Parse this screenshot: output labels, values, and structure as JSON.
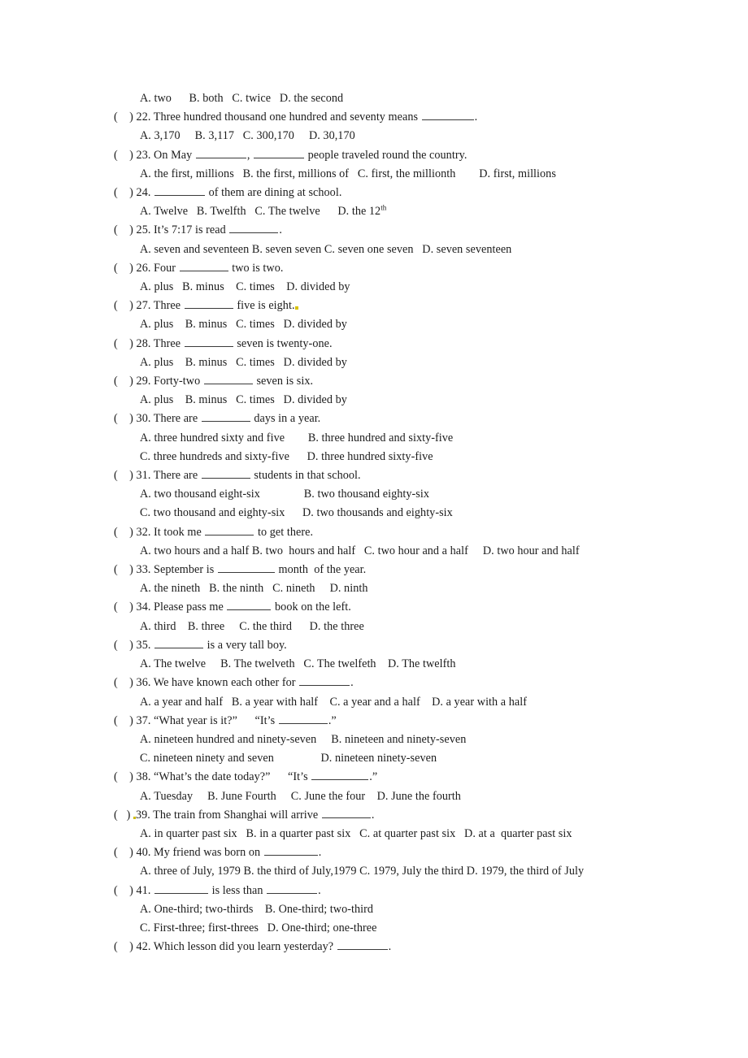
{
  "document": {
    "type": "worksheet",
    "subject": "English grammar multiple-choice exercise",
    "topic": "numbers, ordinals, fractions and dates",
    "page_background": "#ffffff",
    "text_color": "#1c1c1c",
    "artifact_color": "#d8c200"
  },
  "orphan_options": {
    "label": "A. two      B. both   C. twice   D. the second"
  },
  "questions": [
    {
      "id": "q22",
      "box": "(    ) ",
      "number": "22.",
      "stem": " Three hundred thousand one hundred and seventy means ",
      "stem_tail": ".",
      "options": [
        {
          "lines": [
            "A. 3,170     B. 3,117   C. 300,170     D. 30,170"
          ]
        }
      ]
    },
    {
      "id": "q23",
      "box": "(    ) ",
      "number": "23.",
      "stem": " On May ",
      "stem_mid": ", ",
      "stem_tail": " people traveled round the country.",
      "options": [
        {
          "lines": [
            "A. the first, millions   B. the first, millions of   C. first, the millionth        D. first, millions"
          ]
        }
      ]
    },
    {
      "id": "q24",
      "box": "(    ) ",
      "number": "24.",
      "stem": " ",
      "stem_tail": " of them are dining at school.",
      "options": [
        {
          "lines": [
            "A. Twelve   B. Twelfth   C. The twelve      D. the 12"
          ],
          "superscript": "th"
        }
      ]
    },
    {
      "id": "q25",
      "box": "(    ) ",
      "number": "25.",
      "stem": " It’s 7:17 is read ",
      "stem_tail": ".",
      "options": [
        {
          "lines": [
            "A. seven and seventeen B. seven seven C. seven one seven   D. seven seventeen"
          ]
        }
      ]
    },
    {
      "id": "q26",
      "box": "(    ) ",
      "number": "26.",
      "stem": " Four ",
      "stem_tail": " two is two.",
      "options": [
        {
          "lines": [
            "A. plus   B. minus    C. times    D. divided by"
          ]
        }
      ]
    },
    {
      "id": "q27",
      "box": "(    ) ",
      "number": "27.",
      "stem": " Three ",
      "stem_tail": " five is eight.",
      "options": [
        {
          "lines": [
            "A. plus    B. minus   C. times   D. divided by"
          ]
        }
      ]
    },
    {
      "id": "q28",
      "box": "(    ) ",
      "number": "28.",
      "stem": " Three ",
      "stem_tail": " seven is twenty-one.",
      "options": [
        {
          "lines": [
            "A. plus    B. minus   C. times   D. divided by"
          ]
        }
      ]
    },
    {
      "id": "q29",
      "box": "(    ) ",
      "number": "29.",
      "stem": " Forty-two ",
      "stem_tail": " seven is six.",
      "options": [
        {
          "lines": [
            "A. plus    B. minus   C. times   D. divided by"
          ]
        }
      ]
    },
    {
      "id": "q30",
      "box": "(    ) ",
      "number": "30.",
      "stem": " There are ",
      "stem_tail": " days in a year.",
      "options": [
        {
          "lines": [
            "A. three hundred sixty and five        B. three hundred and sixty-five"
          ]
        },
        {
          "lines": [
            "C. three hundreds and sixty-five      D. three hundred sixty-five"
          ]
        }
      ]
    },
    {
      "id": "q31",
      "box": "(    ) ",
      "number": "31.",
      "stem": " There are ",
      "stem_tail": " students in that school.",
      "options": [
        {
          "lines": [
            "A. two thousand eight-six               B. two thousand eighty-six"
          ]
        },
        {
          "lines": [
            "C. two thousand and eighty-six      D. two thousands and eighty-six"
          ]
        }
      ]
    },
    {
      "id": "q32",
      "box": "(    ) ",
      "number": "32.",
      "stem": " It took me ",
      "stem_tail": " to get there.",
      "options": [
        {
          "lines": [
            "A. two hours and a half B. two  hours and half   C. two hour and a half     D. two hour and half"
          ]
        }
      ]
    },
    {
      "id": "q33",
      "box": "(    ) ",
      "number": "33.",
      "stem": " September is ",
      "stem_tail": " month  of the year.",
      "options": [
        {
          "lines": [
            "A. the nineth   B. the ninth   C. nineth     D. ninth"
          ]
        }
      ]
    },
    {
      "id": "q34",
      "box": "(    ) ",
      "number": "34.",
      "stem": " Please pass me ",
      "stem_tail": " book on the left.",
      "options": [
        {
          "lines": [
            "A. third    B. three     C. the third      D. the three"
          ]
        }
      ]
    },
    {
      "id": "q35",
      "box": "(    ) ",
      "number": "35.",
      "stem": " ",
      "stem_tail": " is a very tall boy.",
      "options": [
        {
          "lines": [
            "A. The twelve     B. The twelveth   C. The twelfeth    D. The twelfth"
          ]
        }
      ]
    },
    {
      "id": "q36",
      "box": "(    ) ",
      "number": "36.",
      "stem": " We have known each other for ",
      "stem_tail": ".",
      "options": [
        {
          "lines": [
            "A. a year and half   B. a year with half    C. a year and a half    D. a year with a half"
          ]
        }
      ]
    },
    {
      "id": "q37",
      "box": "(    ) ",
      "number": "37.",
      "stem": " “What year is it?”      “It’s ",
      "stem_tail": ".”",
      "options": [
        {
          "lines": [
            "A. nineteen hundred and ninety-seven     B. nineteen and ninety-seven"
          ]
        },
        {
          "lines": [
            "C. nineteen ninety and seven                D. nineteen ninety-seven"
          ]
        }
      ]
    },
    {
      "id": "q38",
      "box": "(    ) ",
      "number": "38.",
      "stem": " “What’s the date today?”      “It’s ",
      "stem_tail": ".”",
      "options": [
        {
          "lines": [
            "A. Tuesday     B. June Fourth     C. June the four    D. June the fourth"
          ]
        }
      ]
    },
    {
      "id": "q39",
      "box": "(   ) ",
      "number": "39.",
      "stem": " The train from Shanghai will arrive ",
      "stem_tail": ".",
      "options": [
        {
          "lines": [
            "A. in quarter past six   B. in a quarter past six   C. at quarter past six   D. at a  quarter past six"
          ]
        }
      ]
    },
    {
      "id": "q40",
      "box": "(    ) ",
      "number": "40.",
      "stem": " My friend was born on ",
      "stem_tail": ".",
      "options": [
        {
          "lines": [
            "A. three of July, 1979 B. the third of July,1979 C. 1979, July the third D. 1979, the third of July"
          ]
        }
      ]
    },
    {
      "id": "q41",
      "box": "(    ) ",
      "number": "41.",
      "stem": " ",
      "stem_mid": " is less than ",
      "stem_tail": ".",
      "options": [
        {
          "lines": [
            "A. One-third; two-thirds    B. One-third; two-third"
          ]
        },
        {
          "lines": [
            "C. First-three; first-threes   D. One-third; one-three"
          ]
        }
      ]
    },
    {
      "id": "q42",
      "box": "(    ) ",
      "number": "42.",
      "stem": " Which lesson did you learn yesterday? ",
      "stem_tail": ".",
      "options": []
    }
  ]
}
